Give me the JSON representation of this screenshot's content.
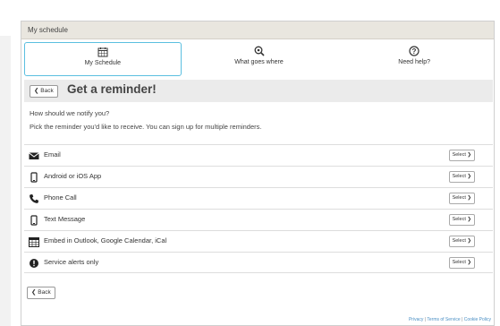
{
  "window": {
    "title": "My schedule"
  },
  "tabs": [
    {
      "label": "My Schedule",
      "icon": "calendar-icon",
      "active": true
    },
    {
      "label": "What goes where",
      "icon": "search-recycle-icon",
      "active": false
    },
    {
      "label": "Need help?",
      "icon": "help-icon",
      "active": false
    }
  ],
  "header": {
    "back_label": "Back",
    "title": "Get a reminder!"
  },
  "intro": {
    "question": "How should we notify you?",
    "instruction": "Pick the reminder you'd like to receive. You can sign up for multiple reminders."
  },
  "options": [
    {
      "label": "Email",
      "icon": "envelope-icon",
      "button": "Select"
    },
    {
      "label": "Android or iOS App",
      "icon": "mobile-icon",
      "button": "Select"
    },
    {
      "label": "Phone Call",
      "icon": "phone-icon",
      "button": "Select"
    },
    {
      "label": "Text Message",
      "icon": "mobile-icon",
      "button": "Select"
    },
    {
      "label": "Embed in Outlook, Google Calendar, iCal",
      "icon": "calendar-icon",
      "button": "Select"
    },
    {
      "label": "Service alerts only",
      "icon": "alert-icon",
      "button": "Select"
    }
  ],
  "bottom": {
    "back_label": "Back"
  },
  "footer": {
    "privacy": "Privacy",
    "terms": "Terms of Service",
    "cookie": "Cookie Policy",
    "separator": "|"
  },
  "colors": {
    "active_tab_border": "#5bbfe0",
    "link": "#4a8fc4",
    "titlebar": "#e9e6df"
  }
}
